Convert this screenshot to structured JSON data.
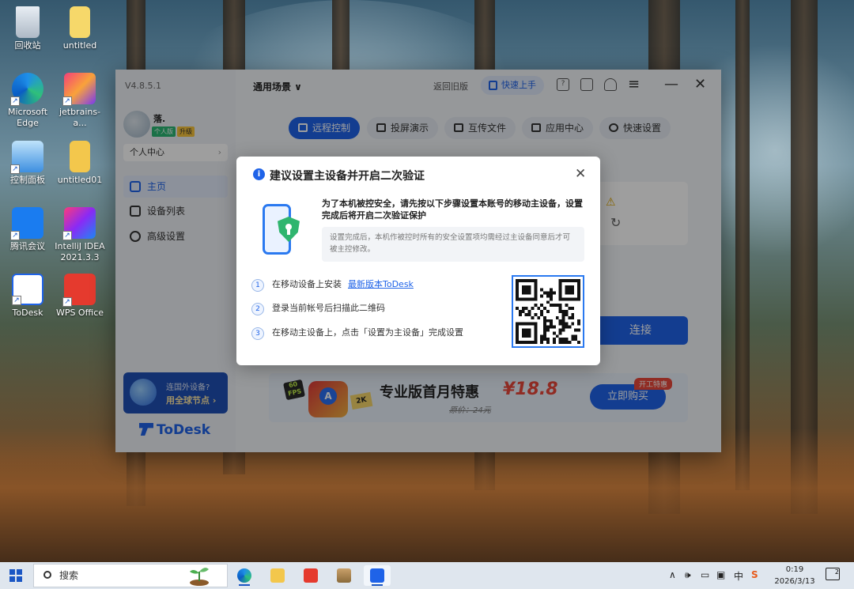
{
  "desktop": {
    "icons": [
      {
        "label": "回收站",
        "icon": "recycle-bin-icon"
      },
      {
        "label": "untitled",
        "icon": "file-icon"
      },
      {
        "label": "Microsoft Edge",
        "icon": "edge-icon"
      },
      {
        "label": "jetbrains-a...",
        "icon": "jetbrains-icon"
      },
      {
        "label": "控制面板",
        "icon": "control-panel-icon"
      },
      {
        "label": "untitled01",
        "icon": "folder-icon"
      },
      {
        "label": "腾讯会议",
        "icon": "tencent-meeting-icon"
      },
      {
        "label": "IntelliJ IDEA 2021.3.3",
        "icon": "intellij-icon"
      },
      {
        "label": "ToDesk",
        "icon": "todesk-icon"
      },
      {
        "label": "WPS Office",
        "icon": "wps-icon"
      }
    ]
  },
  "app": {
    "version": "V4.8.5.1",
    "user": {
      "name": "落.",
      "edition_badge": "个人版",
      "upgrade_badge": "升级"
    },
    "personal_center": "个人中心",
    "nav": [
      {
        "label": "主页",
        "active": true
      },
      {
        "label": "设备列表",
        "active": false
      },
      {
        "label": "高级设置",
        "active": false
      }
    ],
    "side_promo": {
      "line1": "连国外设备?",
      "line2": "用全球节点 ›"
    },
    "logo_text": "ToDesk",
    "topbar": {
      "scene": "通用场景 ∨",
      "back_old": "返回旧版",
      "quick_start": "快速上手"
    },
    "tabs": [
      "远程控制",
      "投屏演示",
      "互传文件",
      "应用中心",
      "快速设置"
    ],
    "connect_label": "连接",
    "banner": {
      "badge_fps": "60 FPS",
      "badge_2k": "2K",
      "title": "专业版首月特惠",
      "price": "¥18.8",
      "original": "原价：24元",
      "buy": "立即购买",
      "tag": "开工特惠"
    }
  },
  "modal": {
    "title": "建议设置主设备并开启二次验证",
    "description": "为了本机被控安全，请先按以下步骤设置本账号的移动主设备，设置完成后将开启二次验证保护",
    "note": "设置完成后，本机作被控时所有的安全设置项均需经过主设备同意后才可被主控修改。",
    "steps": [
      {
        "num": "1",
        "text": "在移动设备上安装",
        "link": "最新版本ToDesk"
      },
      {
        "num": "2",
        "text": "登录当前帐号后扫描此二维码",
        "link": ""
      },
      {
        "num": "3",
        "text": "在移动主设备上，点击「设置为主设备」完成设置",
        "link": ""
      }
    ]
  },
  "taskbar": {
    "search_placeholder": "搜索",
    "apps": [
      "edge-icon",
      "file-explorer-icon",
      "wps-icon",
      "package-icon",
      "todesk-icon"
    ],
    "tray_time": "0:19",
    "tray_date": "2026/3/13",
    "ime": "中",
    "notification_count": "2"
  },
  "colors": {
    "accent": "#1f63e8",
    "price_red": "#e8483a",
    "shield_green": "#2fb56e"
  }
}
